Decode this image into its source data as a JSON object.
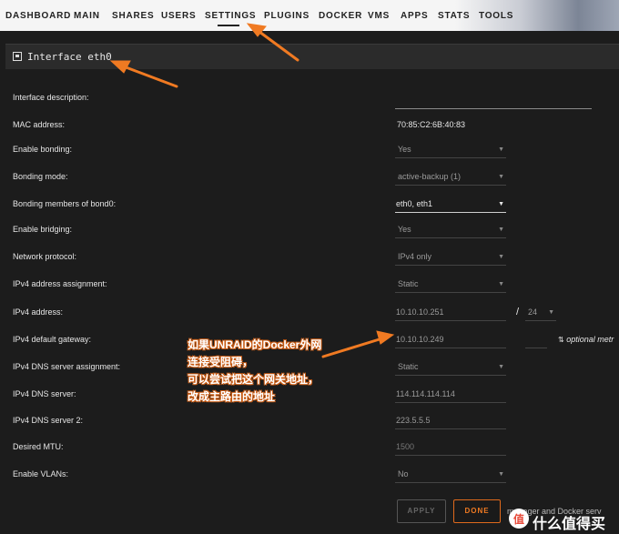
{
  "nav": {
    "items": [
      "DASHBOARD",
      "MAIN",
      "SHARES",
      "USERS",
      "SETTINGS",
      "PLUGINS",
      "DOCKER",
      "VMS",
      "APPS",
      "STATS",
      "TOOLS"
    ],
    "active": "SETTINGS"
  },
  "panel": {
    "title": "Interface eth0"
  },
  "fields": {
    "description": {
      "label": "Interface description:",
      "value": ""
    },
    "mac": {
      "label": "MAC address:",
      "value": "70:85:C2:6B:40:83"
    },
    "bonding": {
      "label": "Enable bonding:",
      "value": "Yes"
    },
    "bonding_mode": {
      "label": "Bonding mode:",
      "value": "active-backup (1)"
    },
    "bond_members": {
      "label": "Bonding members of bond0:",
      "value": "eth0, eth1"
    },
    "bridging": {
      "label": "Enable bridging:",
      "value": "Yes"
    },
    "protocol": {
      "label": "Network protocol:",
      "value": "IPv4 only"
    },
    "ipv4_assignment": {
      "label": "IPv4 address assignment:",
      "value": "Static"
    },
    "ipv4_address": {
      "label": "IPv4 address:",
      "value": "10.10.10.251",
      "prefix_sep": "/",
      "prefix": "24"
    },
    "gateway": {
      "label": "IPv4 default gateway:",
      "value": "10.10.10.249",
      "optional_text": "optional metr"
    },
    "dns_assignment": {
      "label": "IPv4 DNS server assignment:",
      "value": "Static"
    },
    "dns1": {
      "label": "IPv4 DNS server:",
      "value": "114.114.114.114"
    },
    "dns2": {
      "label": "IPv4 DNS server 2:",
      "value": "223.5.5.5"
    },
    "mtu": {
      "label": "Desired MTU:",
      "placeholder": "1500"
    },
    "vlans": {
      "label": "Enable VLANs:",
      "value": "No"
    }
  },
  "buttons": {
    "apply": "APPLY",
    "done": "DONE",
    "trailing_text": "manager and Docker serv"
  },
  "annotation": {
    "lines": [
      "如果UNRAID的Docker外网",
      "连接受阻碍，",
      "可以尝试把这个网关地址，",
      "改成主路由的地址"
    ],
    "color": "#f07a22"
  },
  "watermark": {
    "text": "什么值得买"
  },
  "colors": {
    "accent": "#f07a22",
    "done_border": "#e06a1c",
    "background": "#1c1c1c"
  }
}
